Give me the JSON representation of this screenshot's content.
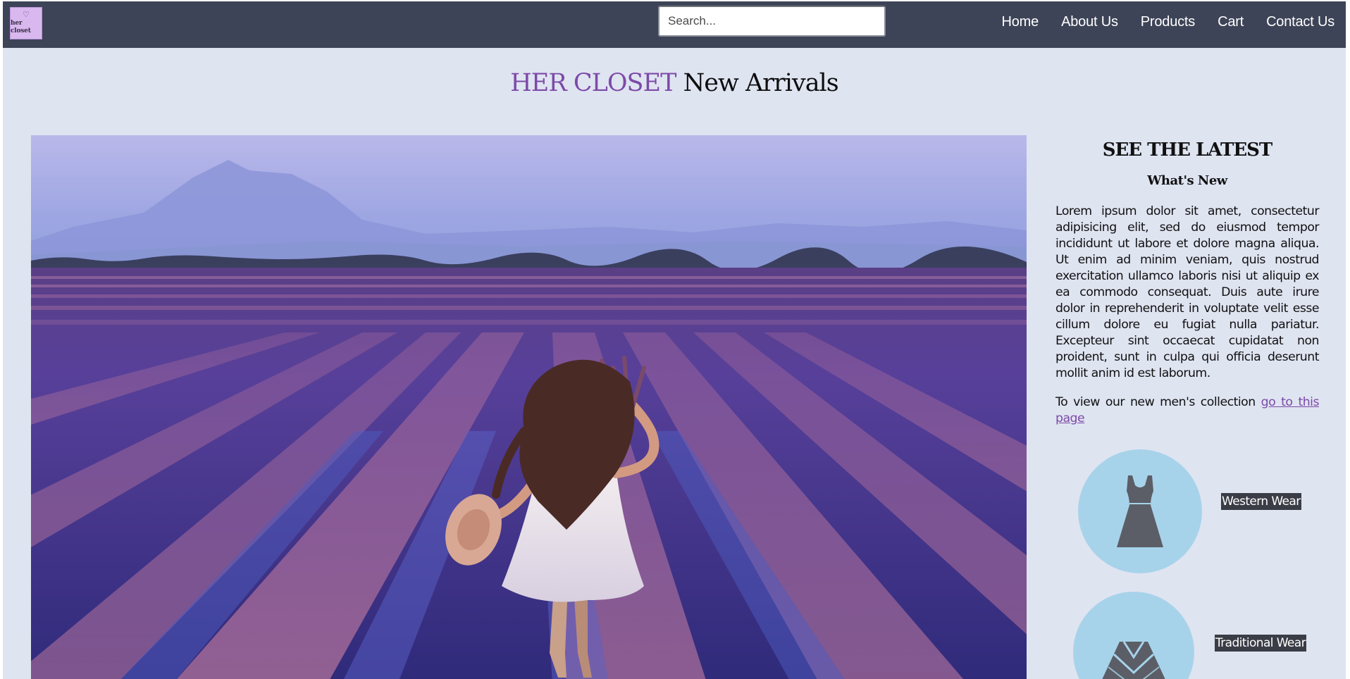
{
  "nav": {
    "logo_text": "her closet",
    "logo_heart": "♡",
    "search_placeholder": "Search...",
    "links": [
      "Home",
      "About Us",
      "Products",
      "Cart",
      "Contact Us"
    ]
  },
  "heading": {
    "brand": "HER CLOSET",
    "rest": "New Arrivals"
  },
  "hero": {
    "image_icon": "lavender-field-photo"
  },
  "sidebar": {
    "title": "SEE THE LATEST",
    "subtitle": "What's New",
    "paragraph": "Lorem ipsum dolor sit amet, consectetur adipisicing elit, sed do eiusmod tempor incididunt ut labore et dolore magna aliqua. Ut enim ad minim veniam, quis nostrud exercitation ullamco laboris nisi ut aliquip ex ea commodo consequat. Duis aute irure dolor in reprehenderit in voluptate velit esse cillum dolore eu fugiat nulla pariatur. Excepteur sint occaecat cupidatat non proident, sunt in culpa qui officia deserunt mollit anim id est laborum.",
    "mens_text": "To view our new men's collection ",
    "mens_link": "go to this page",
    "categories": [
      {
        "label": "Western Wear",
        "icon": "dress-icon"
      },
      {
        "label": "Traditional Wear",
        "icon": "poncho-icon"
      }
    ]
  },
  "colors": {
    "navbar": "#3d4457",
    "page_bg": "#dfe4f1",
    "brand_purple": "#7c4aa8",
    "category_circle": "#a7d3ea",
    "category_label_bg": "#3a3d46"
  }
}
